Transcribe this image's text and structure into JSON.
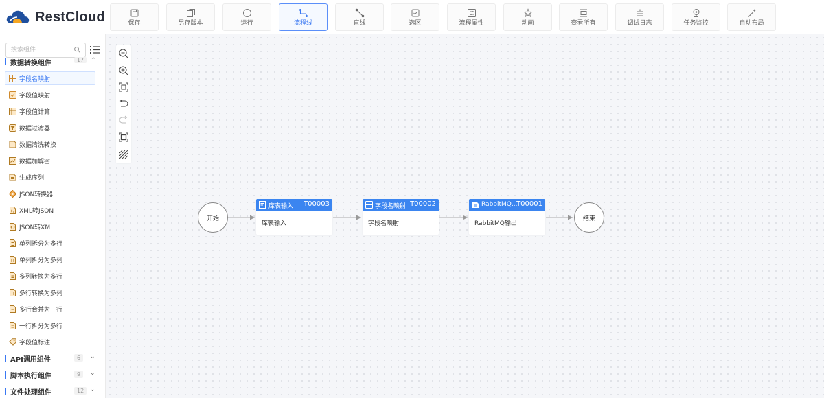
{
  "app": {
    "brand": "RestCloud",
    "accent": "#3a78f2"
  },
  "toolbar": [
    {
      "label": "保存",
      "icon": "save-icon",
      "active": false
    },
    {
      "label": "另存版本",
      "icon": "save-version-icon",
      "active": false
    },
    {
      "label": "运行",
      "icon": "run-icon",
      "active": false
    },
    {
      "label": "流程线",
      "icon": "flow-line-icon",
      "active": true
    },
    {
      "label": "直线",
      "icon": "straight-line-icon",
      "active": false
    },
    {
      "label": "选区",
      "icon": "select-area-icon",
      "active": false
    },
    {
      "label": "流程属性",
      "icon": "flow-properties-icon",
      "active": false
    },
    {
      "label": "动画",
      "icon": "animation-icon",
      "active": false
    },
    {
      "label": "查看所有",
      "icon": "view-all-icon",
      "active": false
    },
    {
      "label": "调试日志",
      "icon": "debug-log-icon",
      "active": false
    },
    {
      "label": "任务监控",
      "icon": "task-monitor-icon",
      "active": false
    },
    {
      "label": "自动布局",
      "icon": "auto-layout-icon",
      "active": false
    }
  ],
  "sidebar": {
    "search_placeholder": "搜索组件",
    "main_group": {
      "title": "数据转换组件",
      "count": "17"
    },
    "items": [
      {
        "label": "字段名映射",
        "selected": true
      },
      {
        "label": "字段值映射",
        "selected": false
      },
      {
        "label": "字段值计算",
        "selected": false
      },
      {
        "label": "数据过滤器",
        "selected": false
      },
      {
        "label": "数据清洗转换",
        "selected": false
      },
      {
        "label": "数据加解密",
        "selected": false
      },
      {
        "label": "生成序列",
        "selected": false
      },
      {
        "label": "JSON转换器",
        "selected": false
      },
      {
        "label": "XML转JSON",
        "selected": false
      },
      {
        "label": "JSON转XML",
        "selected": false
      },
      {
        "label": "单列拆分为多行",
        "selected": false
      },
      {
        "label": "单列拆分为多列",
        "selected": false
      },
      {
        "label": "多列转换为多行",
        "selected": false
      },
      {
        "label": "多行转换为多列",
        "selected": false
      },
      {
        "label": "多行合并为一行",
        "selected": false
      },
      {
        "label": "一行拆分为多行",
        "selected": false
      },
      {
        "label": "字段值标注",
        "selected": false
      }
    ],
    "groups": [
      {
        "title": "API调用组件",
        "count": "6"
      },
      {
        "title": "脚本执行组件",
        "count": "9"
      },
      {
        "title": "文件处理组件",
        "count": "12"
      }
    ]
  },
  "canvas": {
    "start_label": "开始",
    "end_label": "结束",
    "nodes": [
      {
        "name": "库表输入",
        "id": "T00003",
        "body": "库表输入"
      },
      {
        "name": "字段名映射",
        "id": "T00002",
        "body": "字段名映射"
      },
      {
        "name": "RabbitMQ...",
        "id": "T00001",
        "body": "RabbitMQ输出"
      }
    ]
  }
}
